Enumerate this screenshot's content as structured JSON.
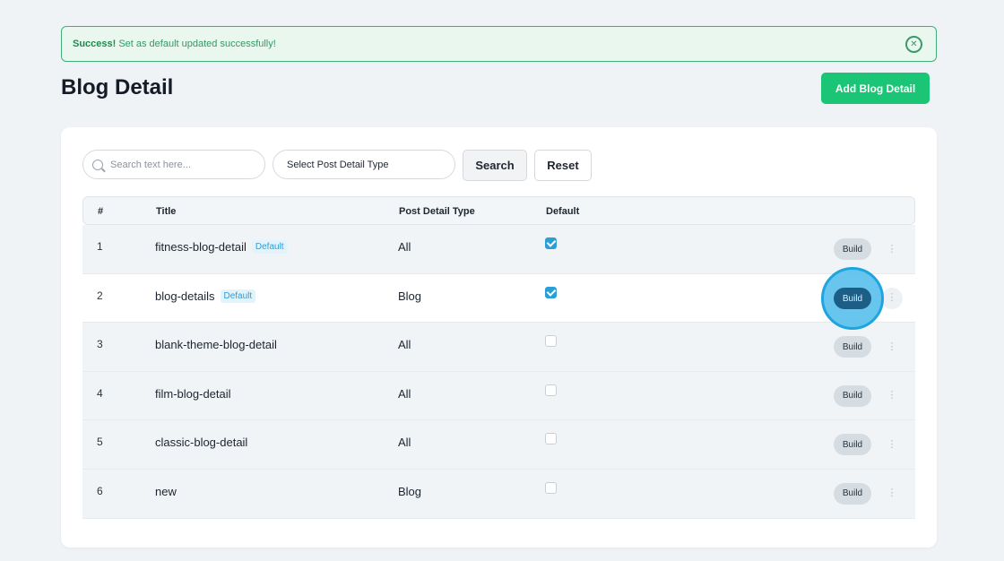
{
  "alert": {
    "strong": "Success!",
    "message": "Set as default updated successfully!",
    "close_icon": "close-circle-icon"
  },
  "page": {
    "title": "Blog Detail",
    "add_button": "Add Blog Detail"
  },
  "filters": {
    "search_placeholder": "Search text here...",
    "search_value": "",
    "type_select": "Select Post Detail Type",
    "search_button": "Search",
    "reset_button": "Reset"
  },
  "table": {
    "columns": {
      "num": "#",
      "title": "Title",
      "type": "Post Detail Type",
      "default": "Default"
    },
    "default_badge": "Default",
    "build_label": "Build",
    "more_icon": "kebab-menu-icon",
    "rows": [
      {
        "num": "1",
        "title": "fitness-blog-detail",
        "is_default": true,
        "type": "All"
      },
      {
        "num": "2",
        "title": "blog-details",
        "is_default": true,
        "type": "Blog"
      },
      {
        "num": "3",
        "title": "blank-theme-blog-detail",
        "is_default": false,
        "type": "All"
      },
      {
        "num": "4",
        "title": "film-blog-detail",
        "is_default": false,
        "type": "All"
      },
      {
        "num": "5",
        "title": "classic-blog-detail",
        "is_default": false,
        "type": "All"
      },
      {
        "num": "6",
        "title": "new",
        "is_default": false,
        "type": "Blog"
      }
    ]
  },
  "colors": {
    "success": "#1ac576",
    "accent": "#2a9fd6",
    "build_active": "#1d5e86"
  }
}
